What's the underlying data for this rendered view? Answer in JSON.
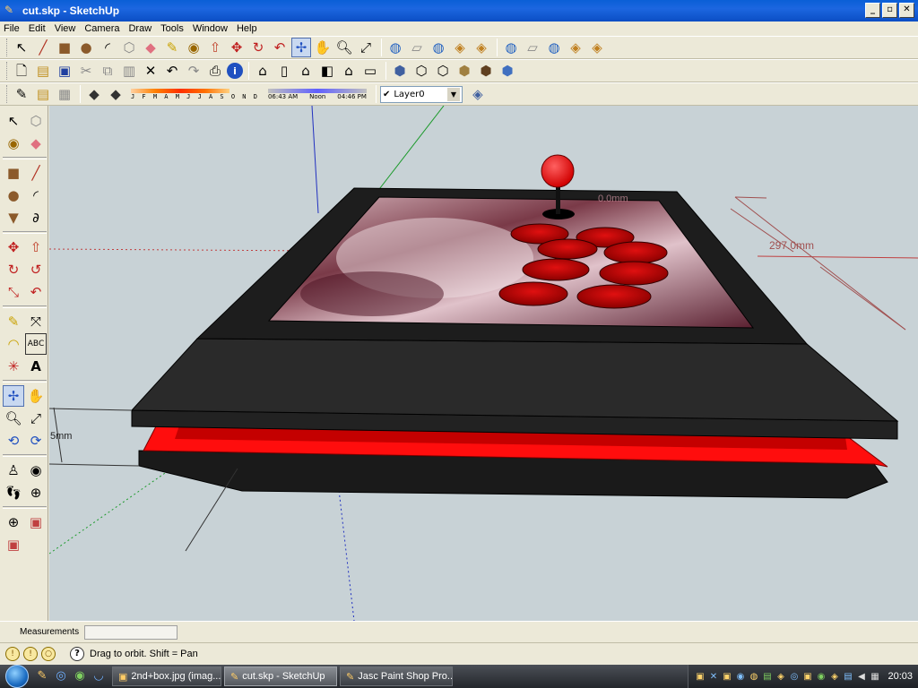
{
  "window": {
    "title": "cut.skp - SketchUp",
    "buttons": {
      "minimize": "_",
      "restore": "▫",
      "close": "✕"
    }
  },
  "menu": [
    "File",
    "Edit",
    "View",
    "Camera",
    "Draw",
    "Tools",
    "Window",
    "Help"
  ],
  "toolbar": {
    "shadow_months": "J F M A M J J A S O N D",
    "time_start": "06:43 AM",
    "time_noon": "Noon",
    "time_end": "04:46 PM",
    "layer": "Layer0"
  },
  "viewport": {
    "dim_width": "297.0mm",
    "dim_height": "5mm",
    "dim_stick": "0.0mm",
    "colors": {
      "background": "#c8d2d6",
      "case": "#1d1d1d",
      "accent": "#ff0d0d",
      "button": "#d60000"
    }
  },
  "measurements": {
    "label": "Measurements",
    "value": ""
  },
  "status": {
    "hint": "Drag to orbit.  Shift = Pan"
  },
  "taskbar": {
    "items": [
      {
        "label": "2nd+box.jpg (imag...",
        "active": false
      },
      {
        "label": "cut.skp - SketchUp",
        "active": true
      },
      {
        "label": "Jasc Paint Shop Pro...",
        "active": false
      }
    ],
    "clock": "20:03"
  }
}
